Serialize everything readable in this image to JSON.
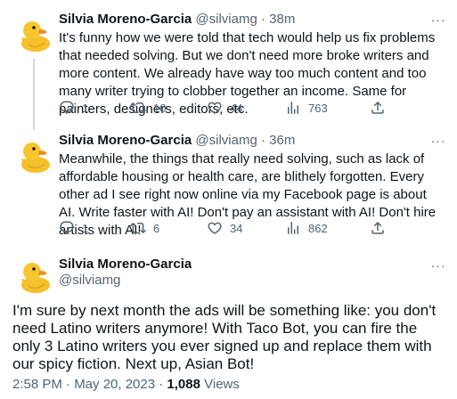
{
  "tweets": [
    {
      "name": "Silvia Moreno-Garcia",
      "handle": "@silviamg",
      "time": "38m",
      "text": "It's funny how we were told that tech would help us fix problems that needed solving. But we don't need more broke writers and more content. We already have way too much content and too many writer trying to clobber together an income. Same for painters, designers, editors, etc.",
      "replies": "1",
      "retweets": "10",
      "likes": "44",
      "views": "763"
    },
    {
      "name": "Silvia Moreno-Garcia",
      "handle": "@silviamg",
      "time": "36m",
      "text": "Meanwhile, the things that really need solving, such as lack of affordable housing or health care, are blithely forgotten. Every other ad I see right now online via my Facebook page is about AI. Write faster with AI! Don't pay an assistant with AI! Don't hire artists with AI!",
      "replies": "1",
      "retweets": "6",
      "likes": "34",
      "views": "862"
    }
  ],
  "main_tweet": {
    "name": "Silvia Moreno-Garcia",
    "handle": "@silviamg",
    "text": "I'm sure by next month the ads will be something like: you don't need Latino writers anymore! With Taco Bot, you can fire the only 3 Latino writers you ever signed up and replace them with our spicy fiction. Next up, Asian Bot!",
    "timestamp": "2:58 PM · May 20, 2023 · ",
    "view_count": "1,088",
    "views_label": " Views"
  },
  "separator": "·",
  "more_glyph": "···",
  "icons": {
    "avatar": "rubber-duck-icon",
    "reply": "reply-icon",
    "retweet": "retweet-icon",
    "like": "heart-icon",
    "views": "views-chart-icon",
    "share": "share-icon",
    "more": "more-dots-icon"
  },
  "colors": {
    "text": "#0f1419",
    "secondary": "#536471",
    "thread_line": "#cfd9de",
    "duck_yellow": "#f7c62f",
    "duck_beak": "#f28c1c"
  }
}
